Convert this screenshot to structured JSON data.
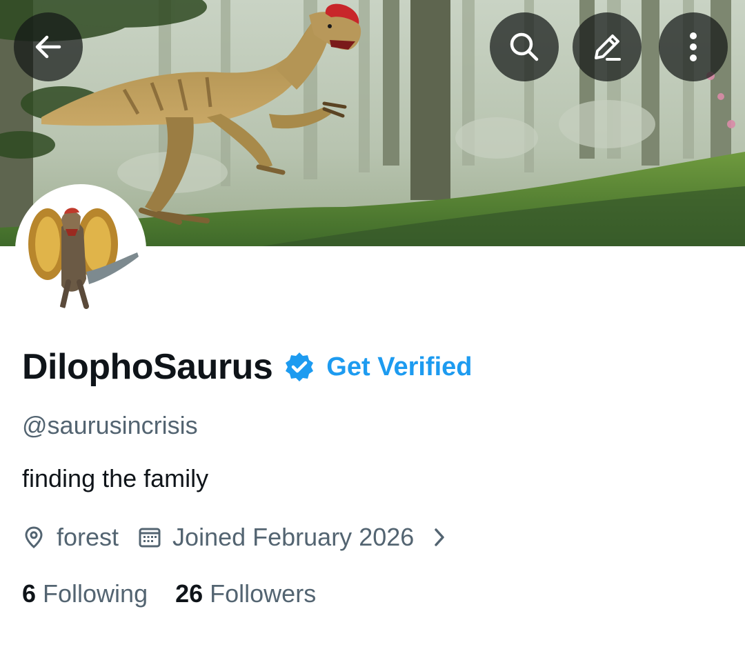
{
  "header": {
    "back_icon": "arrow-left-icon",
    "search_icon": "search-icon",
    "edit_icon": "pencil-icon",
    "more_icon": "vertical-dots-icon"
  },
  "profile": {
    "display_name": "DilophoSaurus",
    "verified_badge_icon": "verified-badge-icon",
    "get_verified_label": "Get Verified",
    "handle": "@saurusincrisis",
    "bio": "finding the family",
    "location": "forest",
    "location_icon": "location-pin-icon",
    "joined": "Joined February 2026",
    "joined_icon": "calendar-icon",
    "more_info_icon": "chevron-right-icon"
  },
  "stats": {
    "following_count": "6",
    "following_label": "Following",
    "followers_count": "26",
    "followers_label": "Followers"
  },
  "colors": {
    "accent": "#1d9bf0",
    "text_primary": "#0f1419",
    "text_secondary": "#536471",
    "button_overlay": "#141816"
  }
}
